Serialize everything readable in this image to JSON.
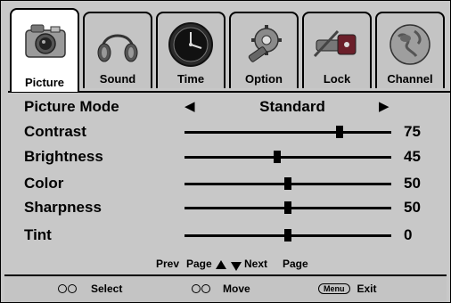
{
  "tabs": [
    {
      "label": "Picture",
      "icon": "camera-icon",
      "active": true
    },
    {
      "label": "Sound",
      "icon": "headphones-icon",
      "active": false
    },
    {
      "label": "Time",
      "icon": "clock-icon",
      "active": false
    },
    {
      "label": "Option",
      "icon": "gear-icon",
      "active": false
    },
    {
      "label": "Lock",
      "icon": "lock-icon",
      "active": false
    },
    {
      "label": "Channel",
      "icon": "globe-icon",
      "active": false
    }
  ],
  "picture_mode": {
    "label": "Picture Mode",
    "value": "Standard",
    "left_arrow": "◀",
    "right_arrow": "▶"
  },
  "settings": [
    {
      "label": "Contrast",
      "value": "75",
      "level": 75
    },
    {
      "label": "Brightness",
      "value": "45",
      "level": 45
    },
    {
      "label": "Color",
      "value": "50",
      "level": 50
    },
    {
      "label": "Sharpness",
      "value": "50",
      "level": 50
    },
    {
      "label": "Tint",
      "value": "0",
      "level": 0
    }
  ],
  "page_nav": {
    "prev": "Prev",
    "page1": "Page",
    "next": "Next",
    "page2": "Page"
  },
  "footer": {
    "select": "Select",
    "move": "Move",
    "menu_key": "Menu",
    "exit": "Exit"
  },
  "colors": {
    "panel": "#c8c8c8",
    "active_tab": "#ffffff",
    "text": "#000000"
  }
}
